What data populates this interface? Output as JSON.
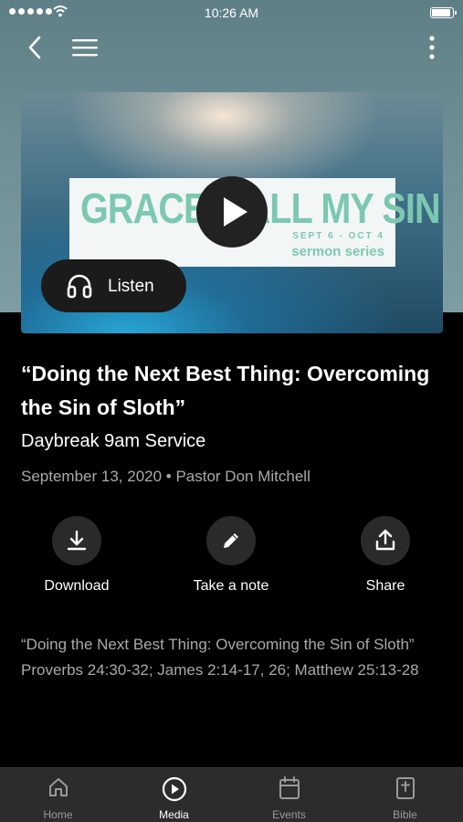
{
  "status_bar": {
    "time": "10:26 AM"
  },
  "artwork": {
    "series_title": "GRACE > ALL MY SIN",
    "series_dates": "SEPT 6 - OCT 4",
    "series_subtitle": "sermon series"
  },
  "listen_label": "Listen",
  "sermon": {
    "title": "“Doing the Next Best Thing: Overcoming the Sin of Sloth”",
    "service": "Daybreak 9am Service",
    "meta": "September 13, 2020 • Pastor Don Mitchell"
  },
  "actions": [
    {
      "label": "Download",
      "icon": "download-icon"
    },
    {
      "label": "Take a note",
      "icon": "pencil-icon"
    },
    {
      "label": "Share",
      "icon": "share-icon"
    }
  ],
  "description": {
    "line1": "“Doing the Next Best Thing: Overcoming the Sin of Sloth”",
    "line2": "Proverbs 24:30-32; James 2:14-17, 26; Matthew 25:13-28"
  },
  "tabs": [
    {
      "label": "Home",
      "icon": "home-icon"
    },
    {
      "label": "Media",
      "icon": "play-circle-icon",
      "active": true
    },
    {
      "label": "Events",
      "icon": "calendar-icon"
    },
    {
      "label": "Bible",
      "icon": "bible-icon"
    }
  ],
  "colors": {
    "accent_teal": "#7cc8b1",
    "tab_active": "#ffffff",
    "tab_inactive": "#9a9a9a"
  }
}
